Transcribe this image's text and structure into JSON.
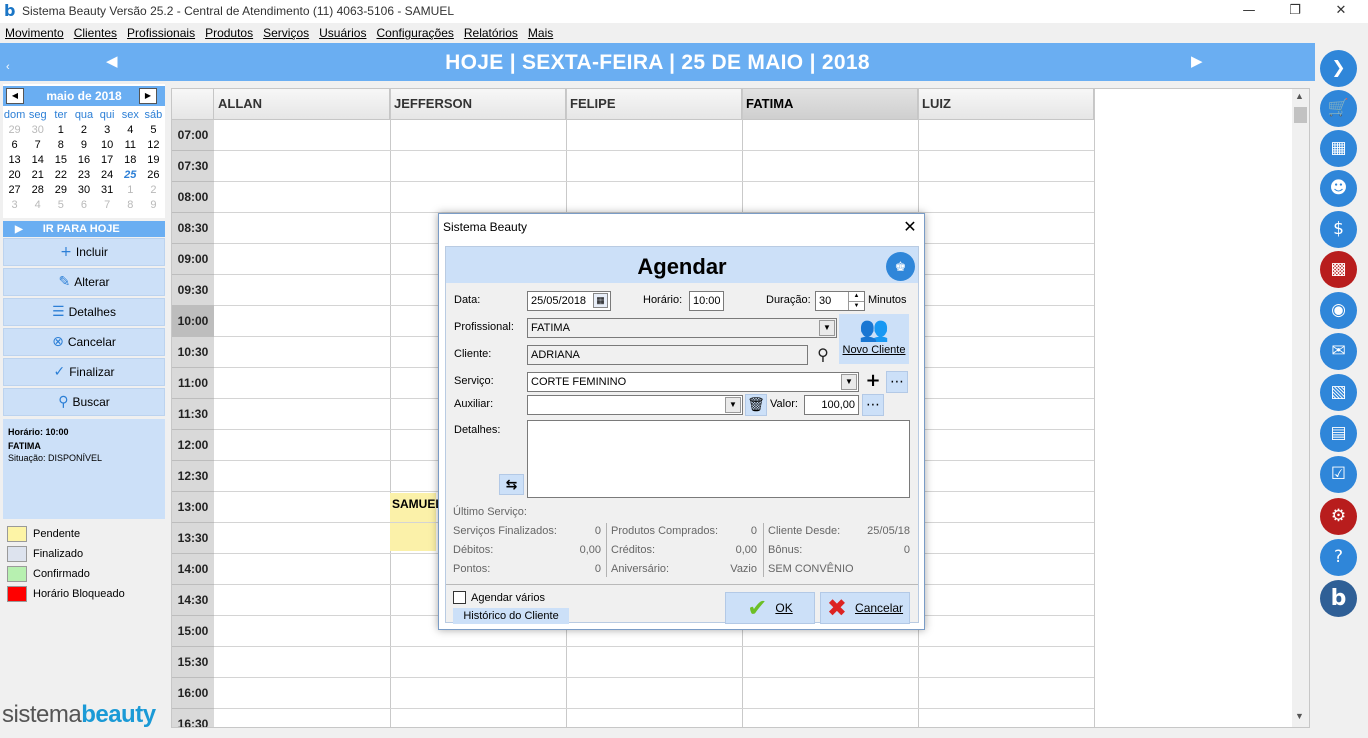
{
  "window": {
    "title": "Sistema Beauty Versão 25.2 - Central de Atendimento (11) 4063-5106 - SAMUEL",
    "logo": "b"
  },
  "menu": [
    "Movimento",
    "Clientes",
    "Profissionais",
    "Produtos",
    "Serviços",
    "Usuários",
    "Configurações",
    "Relatórios",
    "Mais"
  ],
  "header": {
    "date": "HOJE | SEXTA-FEIRA | 25 DE MAIO | 2018"
  },
  "calendar": {
    "month": "maio de 2018",
    "dow": [
      "dom",
      "seg",
      "ter",
      "qua",
      "qui",
      "sex",
      "sáb"
    ],
    "weeks": [
      [
        "29",
        "30",
        "1",
        "2",
        "3",
        "4",
        "5"
      ],
      [
        "6",
        "7",
        "8",
        "9",
        "10",
        "11",
        "12"
      ],
      [
        "13",
        "14",
        "15",
        "16",
        "17",
        "18",
        "19"
      ],
      [
        "20",
        "21",
        "22",
        "23",
        "24",
        "25",
        "26"
      ],
      [
        "27",
        "28",
        "29",
        "30",
        "31",
        "1",
        "2"
      ],
      [
        "3",
        "4",
        "5",
        "6",
        "7",
        "8",
        "9"
      ]
    ],
    "today": "25"
  },
  "left": {
    "goto_today": "IR PARA HOJE",
    "actions": [
      "Incluir",
      "Alterar",
      "Detalhes",
      "Cancelar",
      "Finalizar",
      "Buscar"
    ],
    "info": {
      "line1": "Horário: 10:00",
      "line2": "FATIMA",
      "line3": "Situação: DISPONÍVEL"
    },
    "legend": [
      {
        "label": "Pendente",
        "color": "#fdf4a6"
      },
      {
        "label": "Finalizado",
        "color": "#dde3ee"
      },
      {
        "label": "Confirmado",
        "color": "#b7f0b0"
      },
      {
        "label": "Horário Bloqueado",
        "color": "#ff0000"
      }
    ],
    "brand_a": "sistema",
    "brand_b": "beauty"
  },
  "schedule": {
    "professionals": [
      "ALLAN",
      "JEFFERSON",
      "FELIPE",
      "FATIMA",
      "LUIZ"
    ],
    "times": [
      "07:00",
      "07:30",
      "08:00",
      "08:30",
      "09:00",
      "09:30",
      "10:00",
      "10:30",
      "11:00",
      "11:30",
      "12:00",
      "12:30",
      "13:00",
      "13:30",
      "14:00",
      "14:30",
      "15:00",
      "15:30",
      "16:00",
      "16:30"
    ],
    "appointment": "SAMUEL"
  },
  "dialog": {
    "window_title": "Sistema Beauty",
    "heading": "Agendar",
    "labels": {
      "data": "Data:",
      "horario": "Horário:",
      "duracao": "Duração:",
      "minutos": "Minutos",
      "profissional": "Profissional:",
      "cliente": "Cliente:",
      "servico": "Serviço:",
      "auxiliar": "Auxiliar:",
      "valor": "Valor:",
      "detalhes": "Detalhes:",
      "novo_cliente": "Novo Cliente",
      "ultimo_servico": "Último Serviço:"
    },
    "values": {
      "data": "25/05/2018",
      "horario": "10:00",
      "duracao": "30",
      "profissional": "FATIMA",
      "cliente": "ADRIANA",
      "servico": "CORTE FEMININO",
      "auxiliar": "",
      "valor": "100,00",
      "detalhes": ""
    },
    "stats": {
      "servicos_finalizados": "Serviços Finalizados:",
      "servicos_finalizados_v": "0",
      "debitos": "Débitos:",
      "debitos_v": "0,00",
      "pontos": "Pontos:",
      "pontos_v": "0",
      "produtos_comprados": "Produtos Comprados:",
      "produtos_comprados_v": "0",
      "creditos": "Créditos:",
      "creditos_v": "0,00",
      "aniversario": "Aniversário:",
      "aniversario_v": "Vazio",
      "cliente_desde": "Cliente Desde:",
      "cliente_desde_v": "25/05/18",
      "bonus": "Bônus:",
      "bonus_v": "0",
      "convenio": "SEM CONVÊNIO"
    },
    "agendar_varios": "Agendar vários",
    "historico": "Histórico do Cliente",
    "ok": "OK",
    "cancelar": "Cancelar"
  }
}
